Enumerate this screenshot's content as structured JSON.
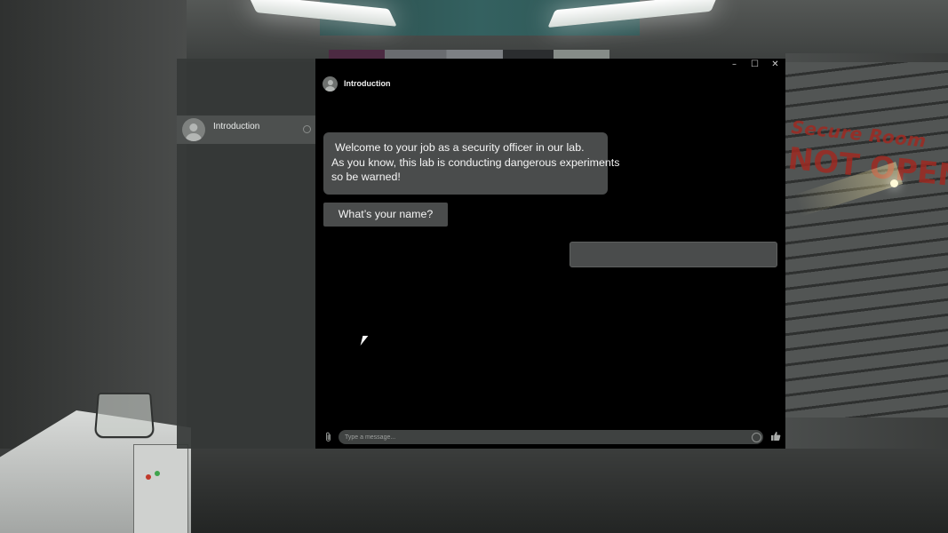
{
  "sidebar": {
    "conversations": [
      {
        "name": "Introduction"
      }
    ]
  },
  "chat": {
    "header": {
      "title": "Introduction"
    },
    "window_controls": {
      "minimize": "–",
      "maximize": "☐",
      "close": "✕"
    },
    "messages": {
      "incoming": {
        "line1": "Welcome to your job as a security officer in our lab.",
        "line2": "As you know, this lab is conducting dangerous experiments",
        "line3": "so be warned!"
      },
      "reply_option": "What’s your name?"
    },
    "composer": {
      "placeholder": "Type a message...",
      "attach_icon": "paperclip-icon",
      "emoji_icon": "emoji-icon",
      "like_icon": "thumbs-up-icon"
    }
  },
  "scene": {
    "sign_line1": "Secure Room",
    "sign_line2": "NOT OPEN"
  },
  "colors": {
    "chat_background": "#000000",
    "bubble": "#4a4c4c",
    "sidebar": "#363938",
    "sign": "#9e2a22"
  }
}
